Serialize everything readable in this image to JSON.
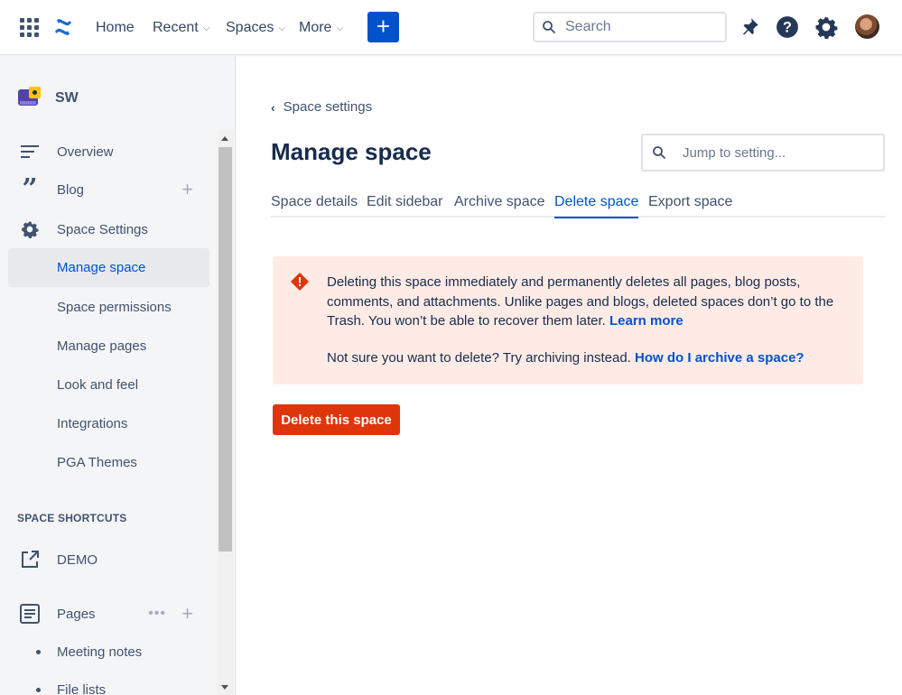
{
  "topnav": {
    "home": "Home",
    "recent": "Recent",
    "spaces": "Spaces",
    "more": "More",
    "create": "+",
    "search_placeholder": "Search"
  },
  "sidebar": {
    "space_name": "SW",
    "items": [
      {
        "label": "Overview"
      },
      {
        "label": "Blog"
      },
      {
        "label": "Space Settings"
      },
      {
        "label": "Manage space"
      },
      {
        "label": "Space permissions"
      },
      {
        "label": "Manage pages"
      },
      {
        "label": "Look and feel"
      },
      {
        "label": "Integrations"
      },
      {
        "label": "PGA Themes"
      }
    ],
    "shortcuts_header": "SPACE SHORTCUTS",
    "shortcuts": [
      {
        "label": "DEMO"
      }
    ],
    "pages_label": "Pages",
    "pages_dots": "•••",
    "plus": "+",
    "pages_children": [
      {
        "label": "Meeting notes"
      },
      {
        "label": "File lists"
      }
    ]
  },
  "main": {
    "back_label": "Space settings",
    "title": "Manage space",
    "jump_placeholder": "Jump to setting...",
    "tabs": [
      {
        "label": "Space details"
      },
      {
        "label": "Edit sidebar"
      },
      {
        "label": "Archive space"
      },
      {
        "label": "Delete space"
      },
      {
        "label": "Export space"
      }
    ],
    "warning": {
      "text": "Deleting this space immediately and permanently deletes all pages, blog posts, comments, and attachments. Unlike pages and blogs, deleted spaces don’t go to the Trash. You won’t be able to recover them later.",
      "learn_more": "Learn more",
      "text2": "Not sure you want to delete? Try archiving instead.",
      "archive_link": "How do I archive a space?"
    },
    "delete_button": "Delete this space"
  },
  "colors": {
    "brand": "#0052cc",
    "danger": "#de350b",
    "warning_bg": "#ffebe6",
    "sidebar_bg": "#f4f5f7"
  }
}
